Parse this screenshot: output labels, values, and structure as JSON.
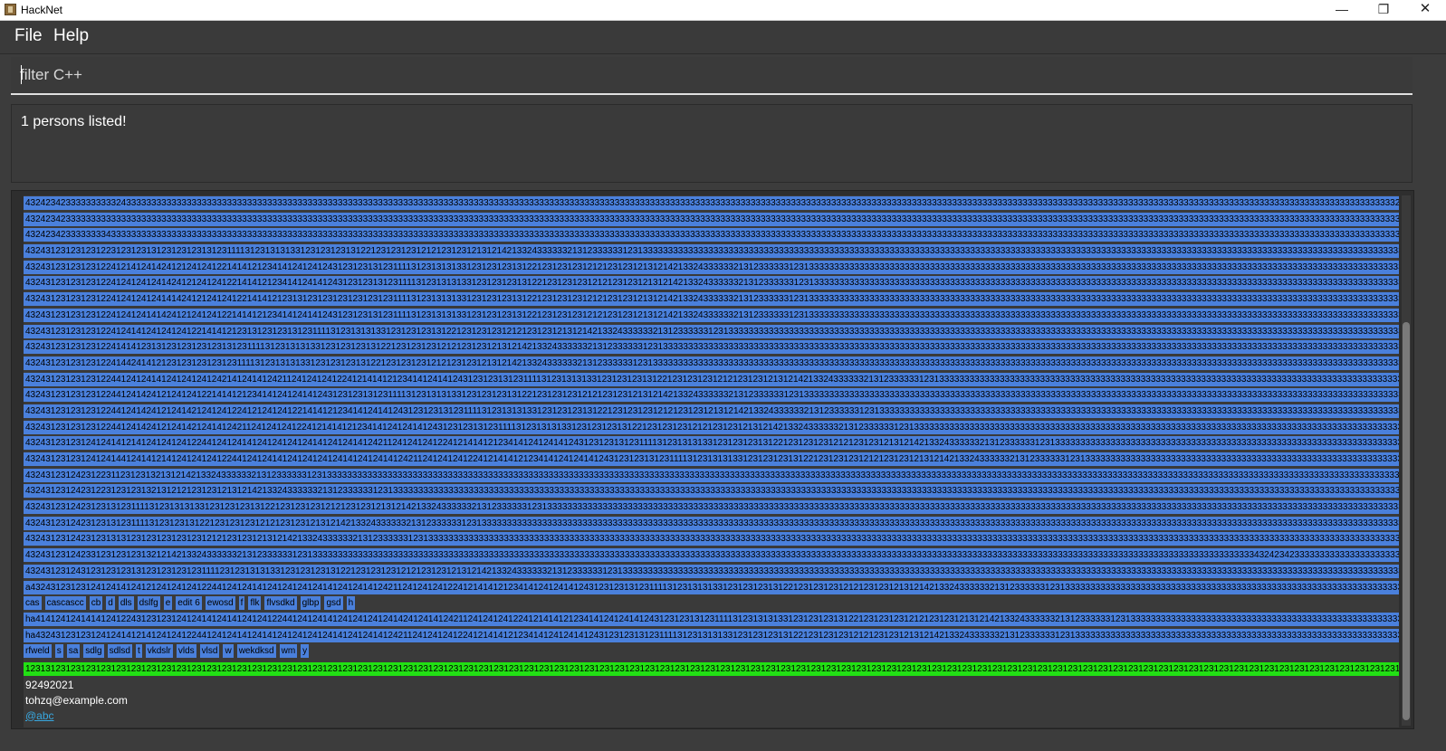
{
  "window": {
    "title": "HackNet",
    "minimize": "—",
    "maximize": "❐",
    "close": "✕"
  },
  "menu": {
    "file": "File",
    "help": "Help"
  },
  "command": {
    "value": "",
    "placeholder": "filter C++"
  },
  "result": {
    "message": "1 persons listed!"
  },
  "person": {
    "tag_rows": [
      [
        "432423423333333333243333333333333333333333333333333333333333333333333333333333333333333333333333333333333333333333333333333333333333333333333333333333333333333333333333333333333333333333333333333333333333333333333333333333333333333333333333333333333333333333333333333333332424234233333333333333333333333333333333333"
      ],
      [
        "432423423333333333333333333333333333333333333333333333333333333333333333333333333333333333333333333333333333333333333333333333333333333333333333333333333333333333333333333333333333333333333333333333333333333333333333333333333333333333333333333333333333333333333333333333333333432423423333333333333333333333333333333333"
      ],
      [
        "432423423333333343333333333333333333333333333333333333333333333333333333333333333333333333333333333333333333333333333333333333333333333333333333333333333333333333333333333333333333333333333333333333333333333333333333333333333333333333333333333333333333333333333333333333333333333333333432423423333333333333333333333333333"
      ],
      [
        "43243123123123122312312313123123123131231111312313131331231231231312212312312312121231231213121421332433333321312333333123133333333333333333333333333333333333333333333333333333333333333333333333333333333333333333333333333333333333333333333333333333333333333333333333333333333333333333333333333333333333333333333333"
      ],
      [
        "43243123123123122412141241424121241241221414121234141241241243123123131231111312313131331231231231312212312312312121231231213121421332433333321312333333123133333333333333333333333333333333333333333333333333333333333333333333333333333333333333333333333333333333333333333333333333333333333333333333333333333333333333"
      ],
      [
        "43243123123123122412412412414241212412412214141212341412414124312312313123111131231313133123123123131221231231231212123123121312142133243333332131233333312313333333333333333333333333333333333333333333333333333333333333333333333333333333333333333333333333333333333333333333333333333333333333333333333333333333333"
      ],
      [
        "43243123123123122412412412414142412124124122141412123131231231231231231231111312313131331231231231312212312312312121231231213121421332433333321312333333123133333333333333333333333333333333333333333333333333333333333333333333333333333333333333333333333333333333333333333333333333333333333333333333333333333333333333"
      ],
      [
        "4324312312312312241241241414241212412412214141212341412414124312312313123111131231313133123123123131221231231231212123123121312142133243333332131233333312313333333333333333333333333333333333333333333333333333333333333333333333333333333333333333333333333333333333333333333333333333333333333333333333333333333333333"
      ],
      [
        "432431231231231224124141241241241221414121231312312313123111131231313133123123123131221231231231212123123121312142133243333332131233333312313333333333333333333333333333333333333333333333333333333333333333333333333333333333333333333333333333333333333333333333333333333333333333333333333333333333333333333333333333"
      ],
      [
        "43243123123123122414141231312312312312313123111131231313133123123123131221231231231212123123121312142133243333332131233333312313333333333333333333333333333333333333333333333333333333333333333333333333333333333333333333333333333333333333333333333333333333333333333333333333333333333333333333333333333333333333333"
      ],
      [
        "432431231231231224144241412123123123123123111131231313133123123123131221231231231212123123121312142133243333332131233333312313333333333333333333333333333333333333333333333333333333333333333333333333333333333333333333333333333333333333333333333333333333333333333333333333333333333333333333333333333333333333333333"
      ],
      [
        "432431231231231224412412414124124124124214124141242112412412412241214141212341412414124312312313123111131231313133123123123131221231231231212123123121312142133243333332131233333312313333333333333333333333333333333333333333333333333333333333333333333333333333333333333333333333333333333333333333333333333333333333"
      ],
      [
        "432431231231231224412414241212412412214141212341412412414124312312313123111131231313133123123123131221231231231212123123121312142133243333332131233333312313333333333333333333333333333333333333333333333333333333333333333333333333333333333333333333333333333333333333333333333333333333333333333333333333333333333333"
      ],
      [
        "432431231231231224412414241212414212412412241212412412214141212341412414124312312313123111131231313133123123123131221231231231212123123121312142133243333332131233333312313333333333333333333333333333333333333333333333333333333333333333333333333333333333333333333333333333333333333333333333333333333333333333333333"
      ],
      [
        "43243123123123122441241424121241421241412421124124124122412141412123414124124141243123123131231111312313131331231231231312212312312312121231231213121421332433333321312333333123133333333333333333333333333333333333333333333333333333333333333333333333333333333333333333333333333333333333333333333333333333333333333"
      ],
      [
        "432431231231241241412141241241241224412412414124124124124141241241412421124124124122412141412123414124124141243123123131231111312313131331231231231312212312312312121231231213121421332433333321312333333123133333333333333333333333333333333333333333333333333333333333333333333333333333333333333333333333333333333"
      ],
      [
        "432431231231241241441241412141241241241224412412414124124124124141241241412421124124124122412141412123414124124141243123123131231111312313131331231231231312212312312312121231231213121421332433333321312333333123133333333333333333333333333333333333333333333333333333333333333333333333333333333333333333333333333333"
      ],
      [
        "432431231242312231123123132131214213324333333213123333331231333333333333333333333333333333333333333333333333333333333333333333333333333333333333333333333333333333333333333333333333333333333333333333333333333333333333333333333333333333333333333333333333333333333333333333333333334324234233333333333333333333333333"
      ],
      [
        "432431231242312231231231321312121231231213121421332433333321312333333123133333333333333333333333333333333333333333333333333333333333333333333333333333333333333333333333333333333333333333333333333333333333333333333333333333333333333333333333333333333333333333333333333333333333333333333333333343242342333333333"
      ],
      [
        "432431231242312313123111131231313133123123123131221231231231212123123121312142133243333332131233333312313333333333333333333333333333333333333333333333333333333333333333333333333333333333333333333333333333333333333333333333333333333333333333333333333333333333333333333333333333333333333333333333333333333333333"
      ],
      [
        "432431231242312313123111131231231312212312312312121231231213121421332433333321312333333123133333333333333333333333333333333333333333333333333333333333333333333333333333333333333333333333333333333333333333333333333333333333333333333333333333333333333333333333333333333333333333333333333333333333333333333333333"
      ],
      [
        "432431231242312313131231231231231231212123123121312142133243333332131233333312313333333333333333333333333333333333333333333333333333333333333333333333333333333333333333333333333333333333333333333333333333333333333333333333333333333333333333333333333333333333333333333333333333333333333333333333333333333333333342"
      ],
      [
        "432431231242331231231231321214213324333333213123333331231333333333333333333333333333333333333333333333333333333333333333333333333333333333333333333333333333333333333333333333333333333333333333333333333333333333333333333333333333333333333333333343242342333333333333333333333333333333333333333333333333333333333333"
      ],
      [
        "432431231243123123123131231231231231111231231313133123123123131221231231231212123123121312142133243333332131233333312313333333333333333333333333333333333333333333333333333333333333333333333333333333333333333333333333333333333333333333333333333333333333333333333333333333333333333333333333333333333333333333333"
      ],
      [
        "a43243123123124124141241212412412412244124124141241241241241412412414124211241241241224121414121234141241241412431231231312311113123131313312312312313122123123123121212312312131214213324333333213123333331231333333333333333333333333333333333333333333333333333333333333333333333333333333333333333333333333333333333333"
      ],
      [
        "cas",
        "cascascc",
        "cb",
        "d",
        "dls",
        "dslfg",
        "e",
        "edit 6",
        "ewosd",
        "f",
        "flk",
        "flvsdkd",
        "glbp",
        "gsd",
        "h"
      ],
      [
        "ha41412412414141241224312312312412414124141241241224412412414124124124124142412414124211241241241224121414121234141241241412431231231312311113123131313312312312313122123123123121212312312131214213324333333213123333331231333333333333333333333333333333333333333333333333333333333333333333333333333333333333333333333"
      ],
      [
        "ha432431231231241241412141241241224412412414124141241241241241412412414124211241241241224121414121234141241241412431231231312311113123131313312312312313122123123123121212312312131214213324333333213123333331231333333333333333333333333333333333333333333333333333333333333333333333333333333333333333333333333333333"
      ],
      [
        "rfweld",
        "s",
        "sa",
        "sdlg",
        "sdlsd",
        "t",
        "vkdslr",
        "vlds",
        "vlsd",
        "w",
        "wekdksd",
        "wm",
        "y"
      ]
    ],
    "green_tag": "1231312312312312312312312312312312312312312312312312312312312312312312312312312312312312312312312312312312312312312312312312312312312312312312312312312312312312312312312312312312312312312312312312312312312312312312312312312312312312312312312312312312312312312312312312312312312312312312312312312312312312312312311",
    "phone": "92492021",
    "email": "tohzq@example.com",
    "handle": "@abc"
  },
  "colors": {
    "tag": "#4a80dc",
    "green_tag": "#22e014",
    "link": "#38a8e0",
    "background": "#3c3c3c"
  },
  "icons": [
    "app-icon",
    "minimize-icon",
    "maximize-icon",
    "close-icon"
  ]
}
